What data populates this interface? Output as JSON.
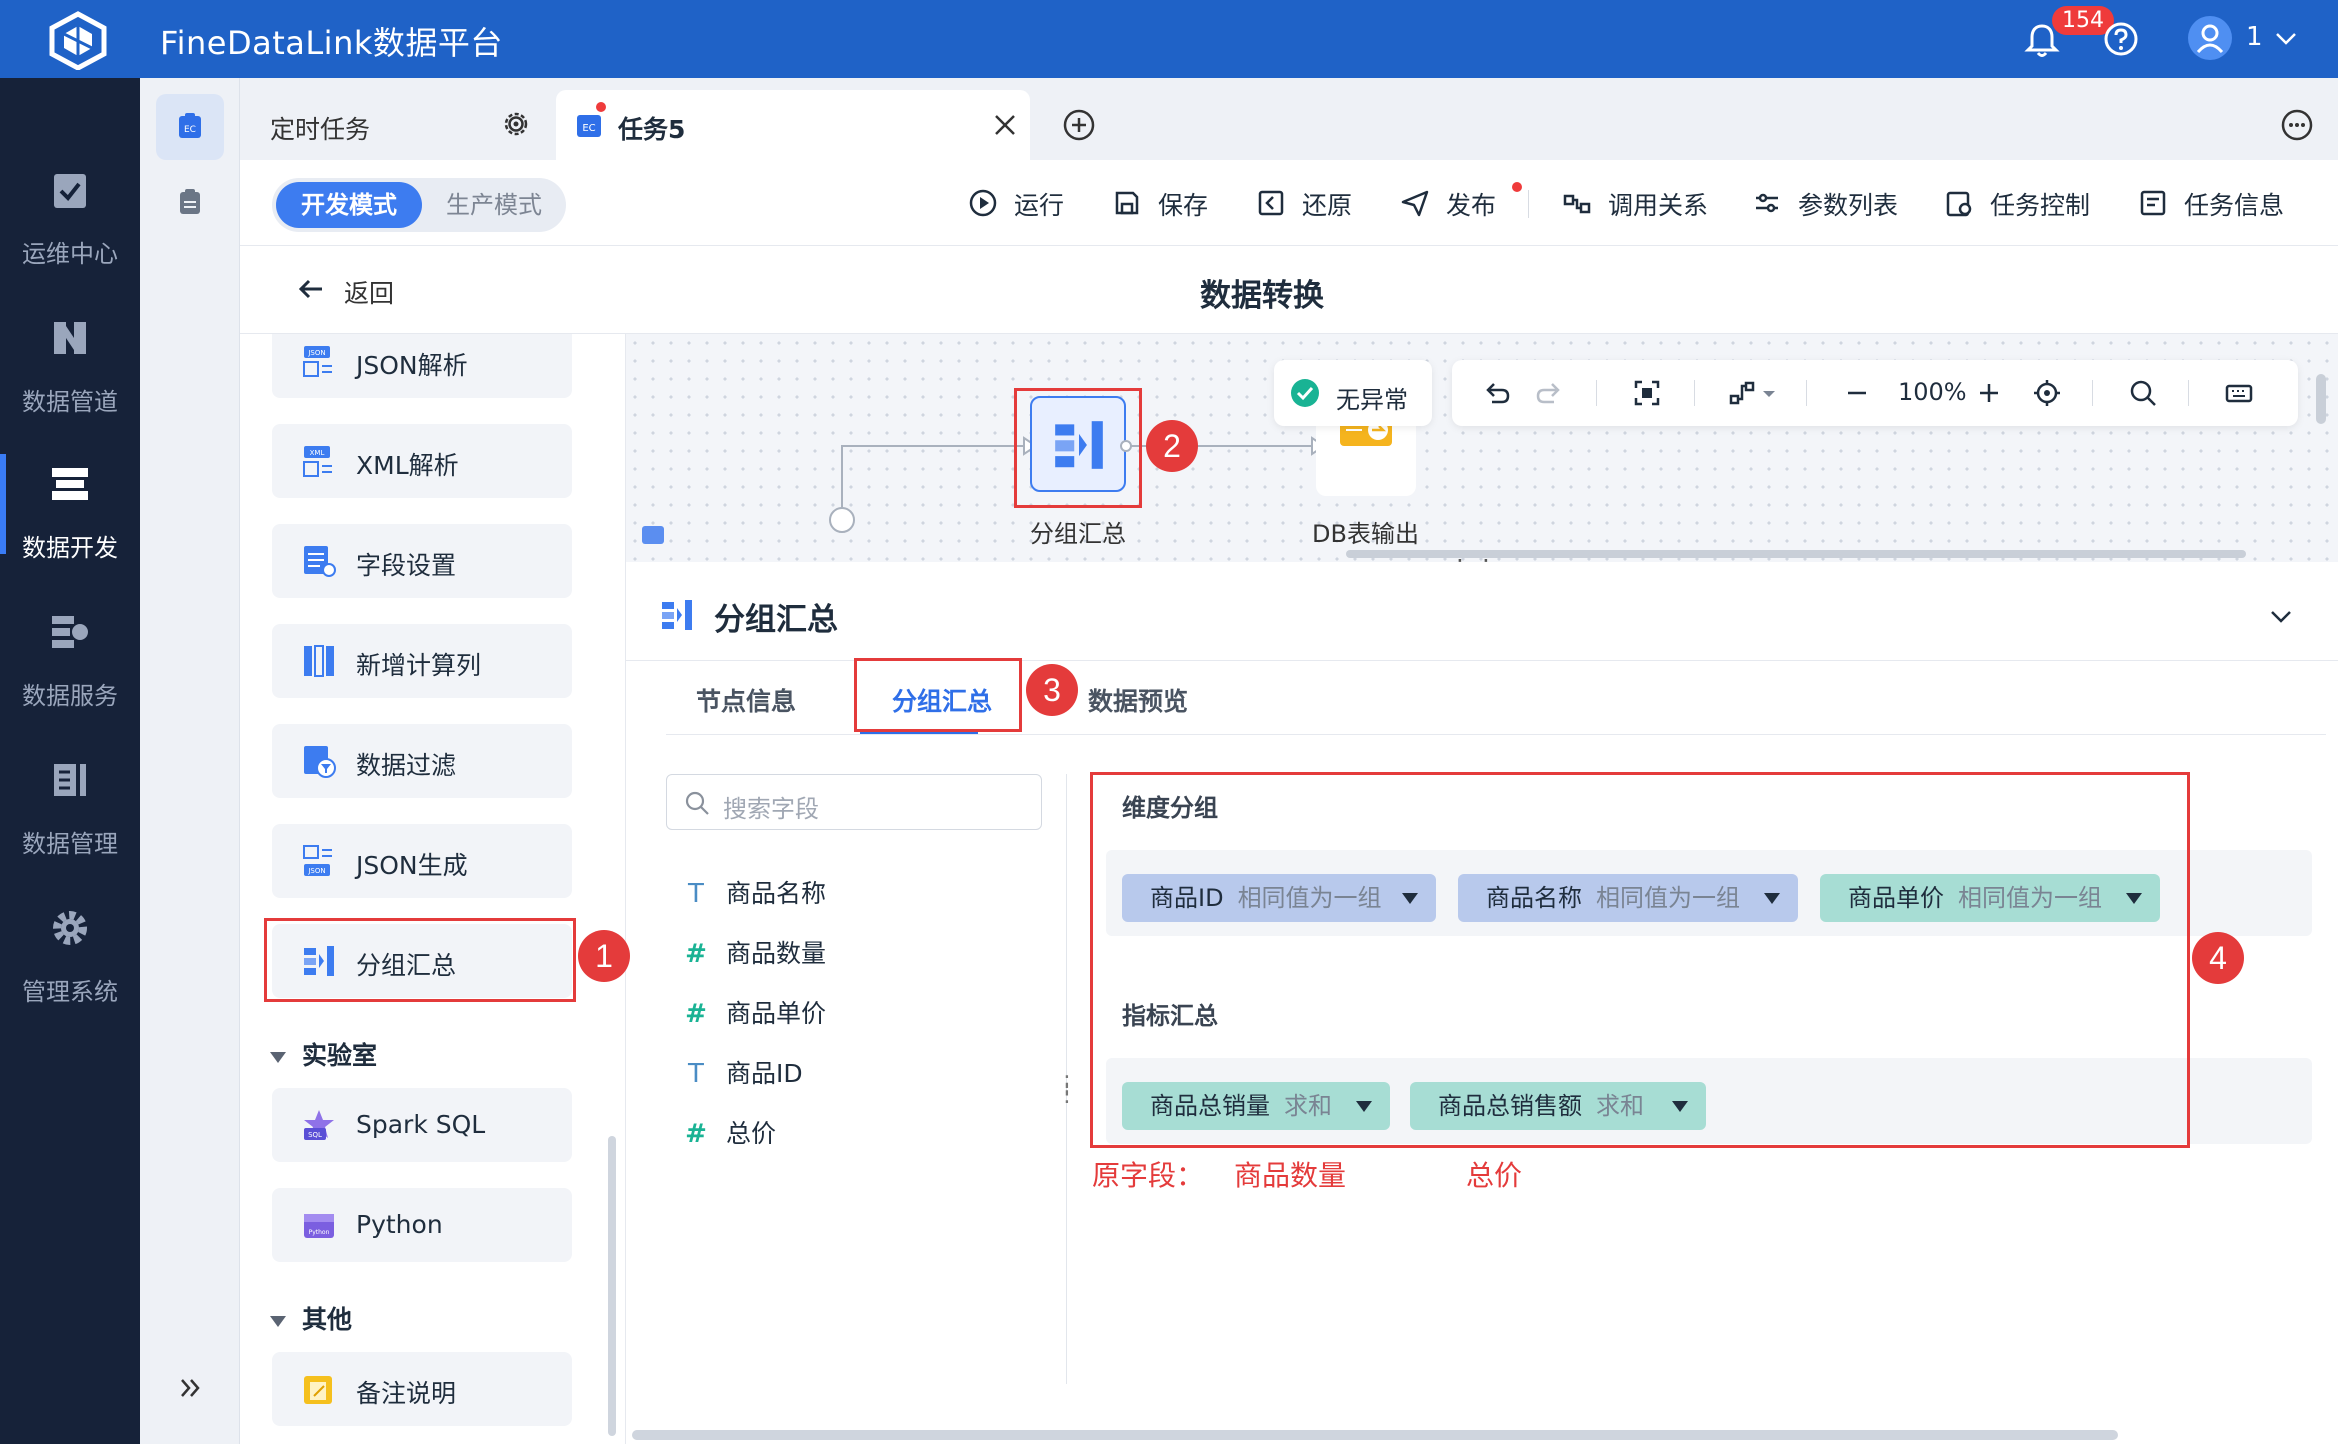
{
  "app": {
    "title": "FineDataLink数据平台",
    "notification_count": "154",
    "user": "1"
  },
  "nav": {
    "items": [
      {
        "label": "运维中心"
      },
      {
        "label": "数据管道"
      },
      {
        "label": "数据开发"
      },
      {
        "label": "数据服务"
      },
      {
        "label": "数据管理"
      },
      {
        "label": "管理系统"
      }
    ],
    "active": "数据开发"
  },
  "tabs": {
    "scheduled": "定时任务",
    "current": "任务5"
  },
  "toolbar": {
    "mode_dev": "开发模式",
    "mode_prod": "生产模式",
    "run": "运行",
    "save": "保存",
    "restore": "还原",
    "publish": "发布",
    "call_relation": "调用关系",
    "param_list": "参数列表",
    "task_control": "任务控制",
    "task_info": "任务信息"
  },
  "header": {
    "back": "返回",
    "title": "数据转换"
  },
  "palette": {
    "items": [
      "JSON解析",
      "XML解析",
      "字段设置",
      "新增计算列",
      "数据过滤",
      "JSON生成",
      "分组汇总"
    ],
    "groups": [
      {
        "label": "实验室",
        "items": [
          "Spark SQL",
          "Python"
        ]
      },
      {
        "label": "其他",
        "items": [
          "备注说明"
        ]
      }
    ]
  },
  "canvas": {
    "status": "无异常",
    "zoom": "100%",
    "nodes": [
      {
        "label": "分组汇总"
      },
      {
        "label": "DB表输出"
      }
    ]
  },
  "panel": {
    "title": "分组汇总",
    "tabs": [
      "节点信息",
      "分组汇总",
      "数据预览"
    ],
    "active_tab": "分组汇总",
    "search_placeholder": "搜索字段",
    "fields": [
      {
        "type": "T",
        "name": "商品名称"
      },
      {
        "type": "#",
        "name": "商品数量"
      },
      {
        "type": "#",
        "name": "商品单价"
      },
      {
        "type": "T",
        "name": "商品ID"
      },
      {
        "type": "#",
        "name": "总价"
      }
    ],
    "dimension_label": "维度分组",
    "dimensions": [
      {
        "name": "商品ID",
        "mode": "相同值为一组"
      },
      {
        "name": "商品名称",
        "mode": "相同值为一组"
      },
      {
        "name": "商品单价",
        "mode": "相同值为一组"
      }
    ],
    "metric_label": "指标汇总",
    "metrics": [
      {
        "name": "商品总销量",
        "agg": "求和"
      },
      {
        "name": "商品总销售额",
        "agg": "求和"
      }
    ],
    "annotation": {
      "prefix": "原字段：",
      "src1": "商品数量",
      "src2": "总价"
    }
  },
  "markers": [
    "1",
    "2",
    "3",
    "4"
  ],
  "colors": {
    "brand": "#1f62c7",
    "nav_bg": "#162239",
    "accent": "#2f6fe8",
    "annotation_red": "#e43b3b"
  }
}
